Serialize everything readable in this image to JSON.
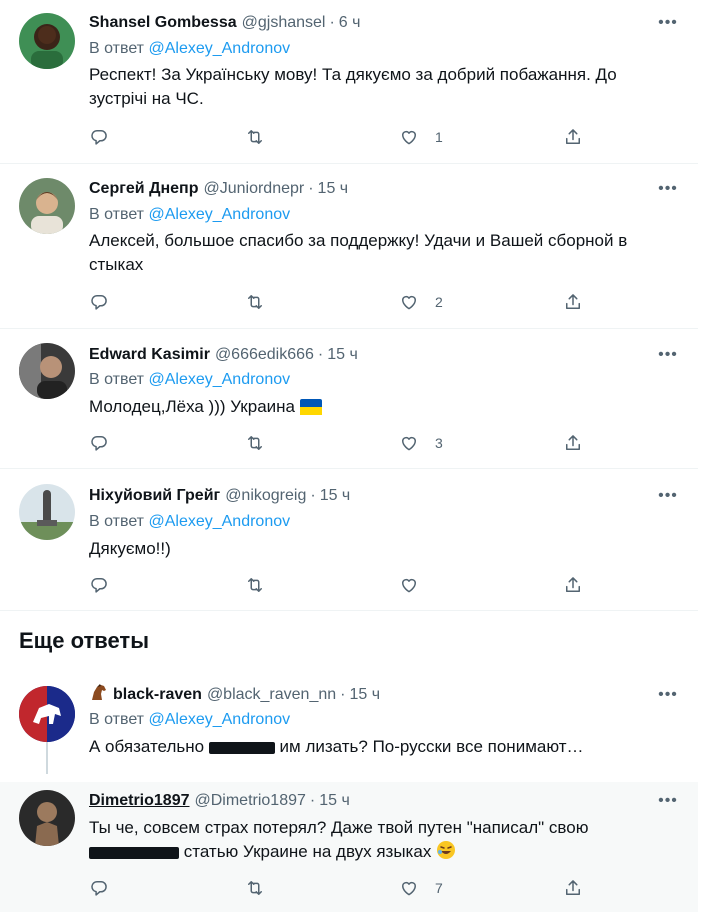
{
  "reply_prefix": "В ответ",
  "tweets": [
    {
      "name": "Shansel Gombessa",
      "handle": "@gjshansel",
      "time": "6 ч",
      "reply_to": "@Alexey_Andronov",
      "text": "Респект! За Українську мову! Та дякуємо за добрий побажання. До зустрічі на ЧС.",
      "likes": "1"
    },
    {
      "name": "Сергей Днепр",
      "handle": "@Juniordnepr",
      "time": "15 ч",
      "reply_to": "@Alexey_Andronov",
      "text": "Алексей, большое спасибо за поддержку! Удачи и Вашей сборной в стыках",
      "likes": "2"
    },
    {
      "name": "Edward Kasimir",
      "handle": "@666edik666",
      "time": "15 ч",
      "reply_to": "@Alexey_Andronov",
      "text": "Молодец,Лёха ))) Украина",
      "likes": "3"
    },
    {
      "name": "Ніхуйовий Грейг",
      "handle": "@nikogreig",
      "time": "15 ч",
      "reply_to": "@Alexey_Andronov",
      "text": "Дякуємо!!)",
      "likes": ""
    },
    {
      "name": "black-raven",
      "handle": "@black_raven_nn",
      "time": "15 ч",
      "reply_to": "@Alexey_Andronov",
      "text_before": "А обязательно",
      "text_after": "им лизать? По-русски все понимают…",
      "likes": ""
    },
    {
      "name": "Dimetrio1897",
      "handle": "@Dimetrio1897",
      "time": "15 ч",
      "text_line1": "Ты че, совсем страх потерял? Даже твой путен \"написал\" свою",
      "text_line2_after": "статью Украине на двух языках",
      "likes": "7"
    }
  ],
  "section_title": "Еще ответы",
  "icons": {
    "reply": "reply-icon",
    "retweet": "retweet-icon",
    "like": "heart-icon",
    "share": "share-icon",
    "more": "more-icon"
  },
  "colors": {
    "link": "#1d9bf0",
    "secondary": "#536471",
    "highlight_bg": "#f7f9f9"
  }
}
